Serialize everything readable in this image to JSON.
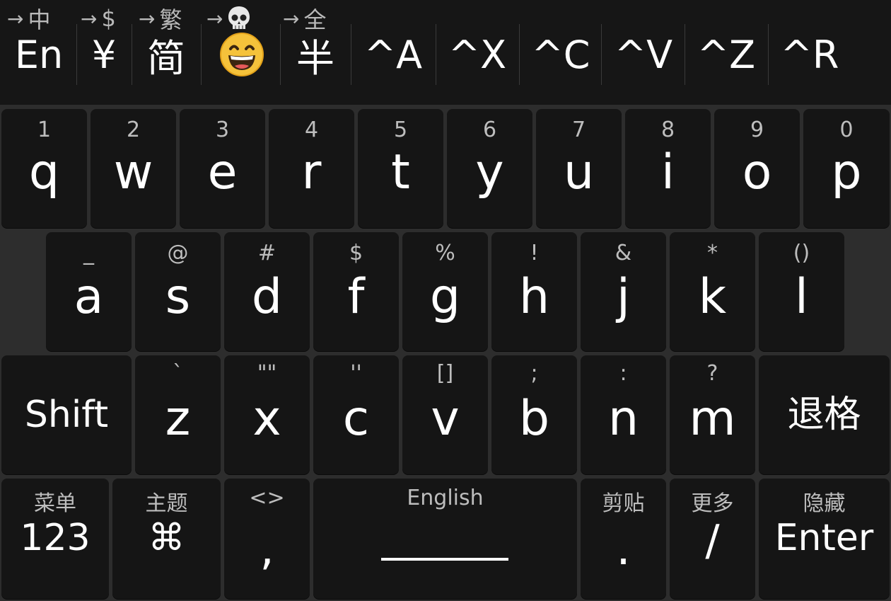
{
  "toolbar": {
    "arrows": [
      {
        "arrow": "→",
        "label": "中"
      },
      {
        "arrow": "→",
        "label": "$"
      },
      {
        "arrow": "→",
        "label": "繁"
      },
      {
        "arrow": "→",
        "label": "",
        "icon": "skull-icon"
      },
      {
        "arrow": "→",
        "label": "全"
      }
    ],
    "buttons": [
      {
        "label": "En"
      },
      {
        "label": "¥"
      },
      {
        "label": "简"
      },
      {
        "label": "",
        "icon": "grinning-face-emoji-icon"
      },
      {
        "label": "半"
      },
      {
        "label": "^A"
      },
      {
        "label": "^X"
      },
      {
        "label": "^C"
      },
      {
        "label": "^V"
      },
      {
        "label": "^Z"
      },
      {
        "label": "^R"
      }
    ]
  },
  "keyboard": {
    "row1": [
      {
        "hint": "1",
        "label": "q"
      },
      {
        "hint": "2",
        "label": "w"
      },
      {
        "hint": "3",
        "label": "e"
      },
      {
        "hint": "4",
        "label": "r"
      },
      {
        "hint": "5",
        "label": "t"
      },
      {
        "hint": "6",
        "label": "y"
      },
      {
        "hint": "7",
        "label": "u"
      },
      {
        "hint": "8",
        "label": "i"
      },
      {
        "hint": "9",
        "label": "o"
      },
      {
        "hint": "0",
        "label": "p"
      }
    ],
    "row2": [
      {
        "hint": "_",
        "label": "a"
      },
      {
        "hint": "@",
        "label": "s"
      },
      {
        "hint": "#",
        "label": "d"
      },
      {
        "hint": "$",
        "label": "f"
      },
      {
        "hint": "%",
        "label": "g"
      },
      {
        "hint": "!",
        "label": "h"
      },
      {
        "hint": "&",
        "label": "j"
      },
      {
        "hint": "*",
        "label": "k"
      },
      {
        "hint": "()",
        "label": "l"
      }
    ],
    "row3": {
      "shift": "Shift",
      "keys": [
        {
          "hint": "`",
          "label": "z"
        },
        {
          "hint": "\"\"",
          "label": "x"
        },
        {
          "hint": "''",
          "label": "c"
        },
        {
          "hint": "[]",
          "label": "v"
        },
        {
          "hint": ";",
          "label": "b"
        },
        {
          "hint": ":",
          "label": "n"
        },
        {
          "hint": "?",
          "label": "m"
        }
      ],
      "backspace": "退格"
    },
    "row4": [
      {
        "hint": "菜单",
        "label": "123"
      },
      {
        "hint": "主题",
        "label": "⌘"
      },
      {
        "hint": "<>",
        "label": ","
      },
      {
        "hint": "English",
        "label": ""
      },
      {
        "hint": "剪贴",
        "label": "."
      },
      {
        "hint": "更多",
        "label": "/"
      },
      {
        "hint": "隐藏",
        "label": "Enter"
      }
    ]
  },
  "colors": {
    "background": "#2d2d2d",
    "key": "#151515",
    "toolbar": "#161616",
    "text": "#ffffff",
    "hint": "#bdbdbd"
  }
}
